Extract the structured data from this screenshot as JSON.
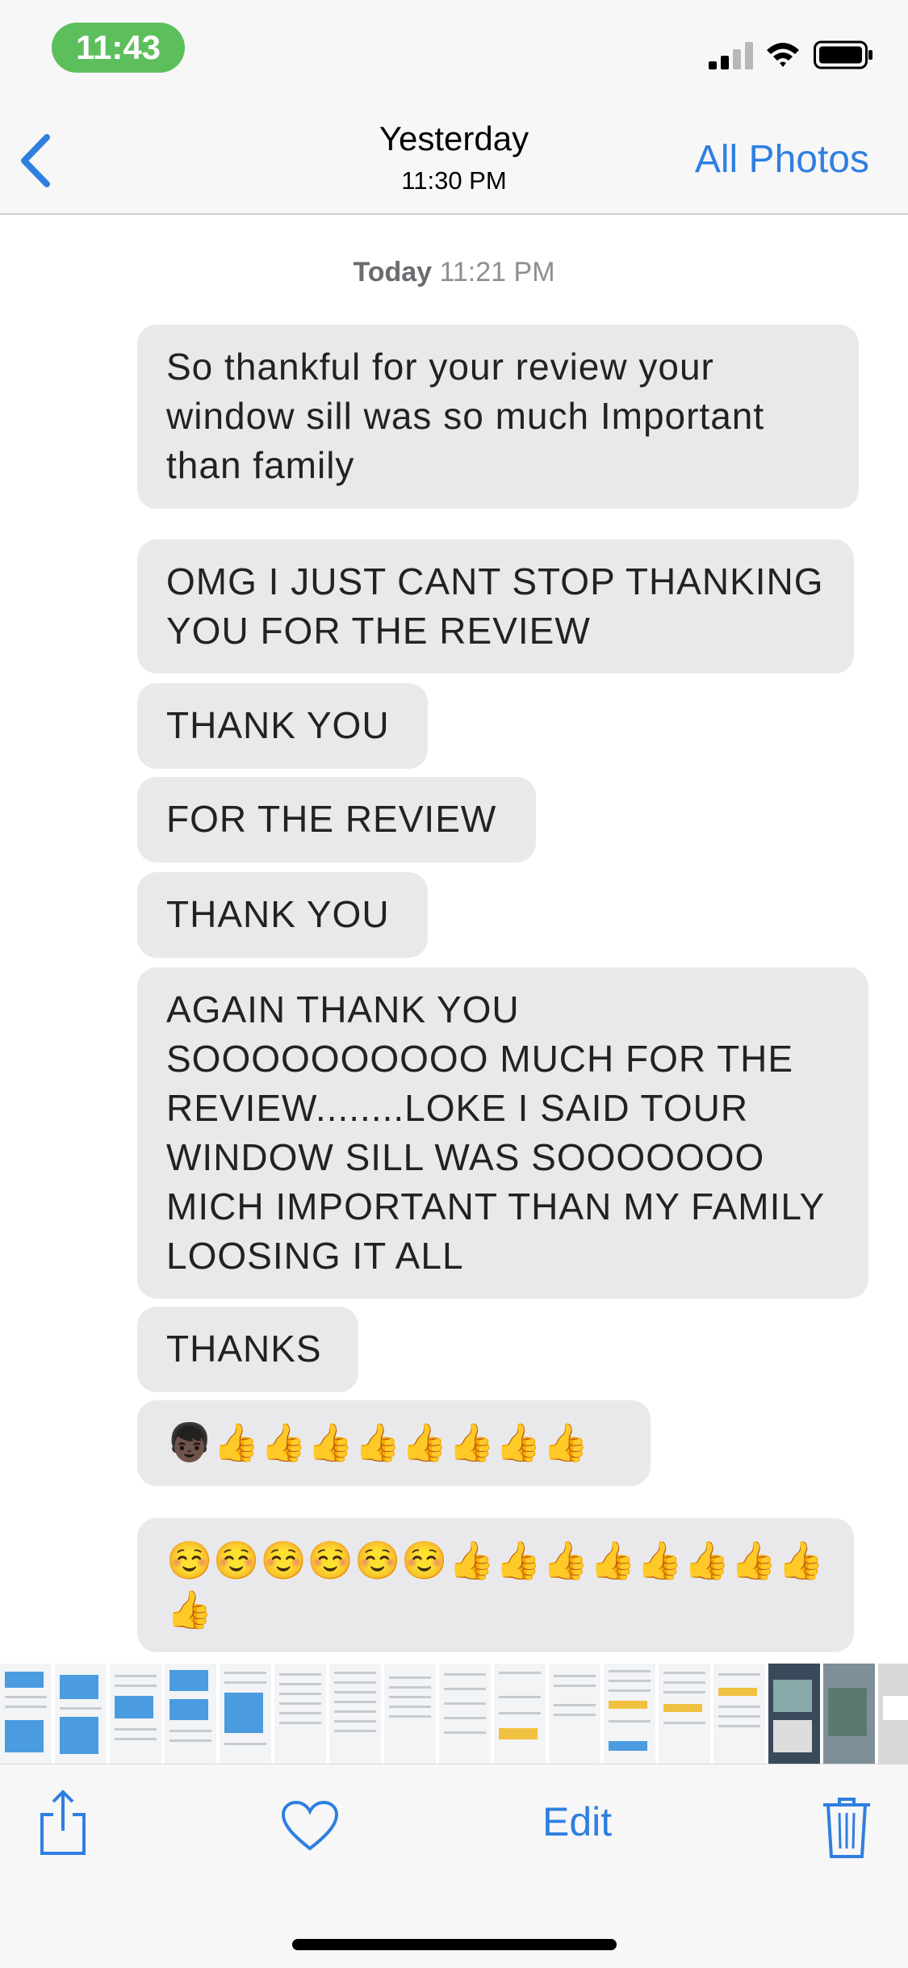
{
  "status_bar": {
    "time": "11:43"
  },
  "nav": {
    "back_icon": "chevron-left-icon",
    "title": "Yesterday",
    "subtitle": "11:30 PM",
    "right_action": "All Photos"
  },
  "conversation": {
    "timestamp_day": "Today",
    "timestamp_time": "11:21 PM",
    "messages": [
      "So thankful for your review your window sill was so much Important than family",
      "OMG I JUST CANT STOP THANKING YOU FOR THE REVIEW",
      "THANK YOU",
      "FOR THE REVIEW",
      "THANK YOU",
      "AGAIN THANK YOU SOOOOOOOOOO MUCH FOR THE REVIEW........LOKE I SAID TOUR WINDOW SILL WAS SOOOOOOO MICH IMPORTANT THAN MY FAMILY LOOSING IT ALL",
      "THANKS",
      "👦🏿👍👍👍👍👍👍👍👍",
      "☺️☺️☺️☺️☺️☺️👍👍👍👍👍👍👍👍👍"
    ]
  },
  "toolbar": {
    "edit_label": "Edit",
    "icons": [
      "share-icon",
      "heart-icon",
      "trash-icon"
    ]
  },
  "colors": {
    "accent": "#2f7fe0",
    "bubble": "#e9e9eb",
    "time_pill": "#5cbf5c"
  }
}
